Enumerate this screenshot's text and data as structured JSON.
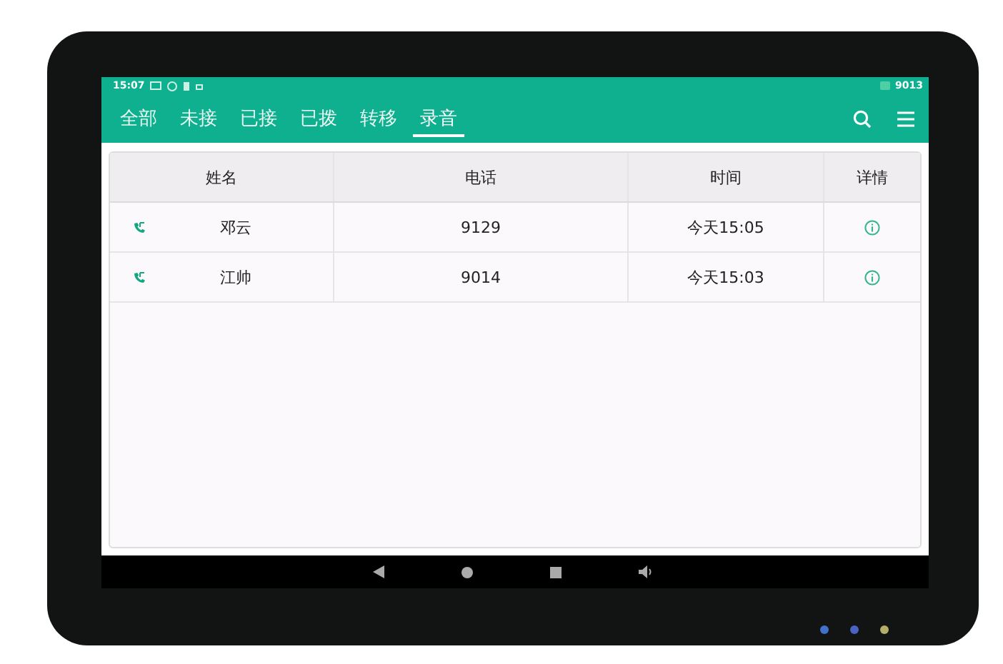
{
  "status_bar": {
    "time": "15:07",
    "extension": "9013"
  },
  "tabs": [
    {
      "label": "全部",
      "selected": false
    },
    {
      "label": "未接",
      "selected": false
    },
    {
      "label": "已接",
      "selected": false
    },
    {
      "label": "已拨",
      "selected": false
    },
    {
      "label": "转移",
      "selected": false
    },
    {
      "label": "录音",
      "selected": true
    }
  ],
  "table": {
    "columns": [
      "姓名",
      "电话",
      "时间",
      "详情"
    ],
    "rows": [
      {
        "name": "邓云",
        "phone": "9129",
        "time": "今天15:05"
      },
      {
        "name": "江帅",
        "phone": "9014",
        "time": "今天15:03"
      }
    ]
  },
  "leds": [
    {
      "color": "#3f72c8"
    },
    {
      "color": "#4a62c0"
    },
    {
      "color": "#b5ae6a"
    }
  ]
}
